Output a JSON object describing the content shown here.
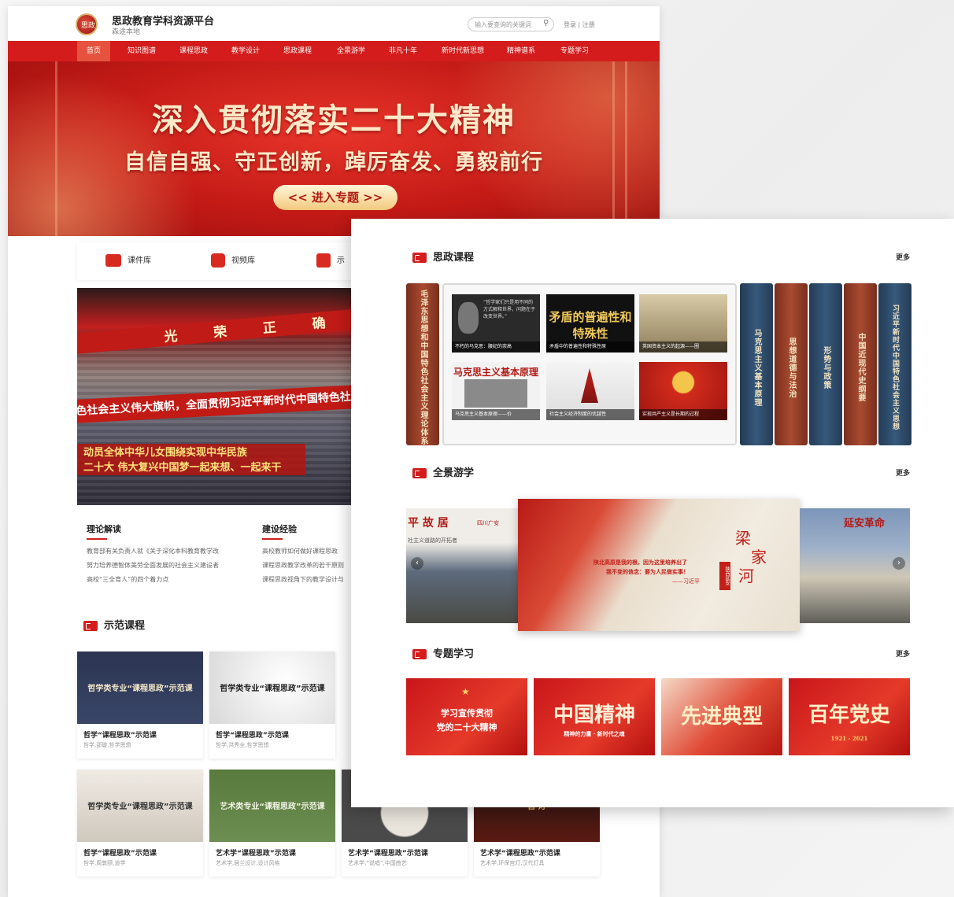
{
  "back": {
    "site_title": "思政教育学科资源平台",
    "site_sub": "森途本地",
    "search_placeholder": "输入要查询的关键词",
    "login": "登录 | 注册",
    "nav": [
      "首页",
      "知识图谱",
      "课程思政",
      "教学设计",
      "思政课程",
      "全景游学",
      "非凡十年",
      "新时代新思想",
      "精神谱系",
      "专题学习"
    ],
    "banner": {
      "title": "深入贯彻落实二十大精神",
      "subtitle": "自信自强、守正创新，踔厉奋发、勇毅前行",
      "button": "<< 进入专题 >>"
    },
    "resources": [
      "课件库",
      "视频库",
      "示"
    ],
    "photo": {
      "banner_text": "光 荣 正 确 的",
      "banner2_text": "色社会主义伟大旗帜，全面贯彻习近平新时代中国特色社会主义思",
      "slogan1": "动员全体中华儿女围绕实现中华民族",
      "slogan2": "二十大  伟大复兴中国梦一起来想、一起来干"
    },
    "news": [
      {
        "heading": "理论解读",
        "items": [
          "教育部有关负责人就《关于深化本科教育教学改",
          "努力培养德智体美劳全面发展的社会主义建设者",
          "高校“三全育人”的四个着力点"
        ]
      },
      {
        "heading": "建设经验",
        "items": [
          "高校教师如何做好课程思政",
          "课程思政教学改革的若干原则",
          "课程思政视角下的教学设计与"
        ]
      }
    ],
    "demo_heading": "示范课程",
    "cards": [
      {
        "img": "哲学类专业“课程思政”示范课",
        "title": "哲学“课程思政”示范课",
        "tags": "哲学,邵璇,哲学思想"
      },
      {
        "img": "哲学类专业“课程思政”示范课",
        "title": "哲学“课程思政”示范课",
        "tags": "哲学,洪秀全,哲学思想"
      },
      {
        "img": "哲学类专业“课程思政”示范课",
        "title": "哲学“课程思政”示范课",
        "tags": "哲学,周敦颐,道学"
      },
      {
        "img": "艺术类专业“课程思政”示范课",
        "title": "艺术学“课程思政”示范课",
        "tags": "艺术学,居兰设计,设计风格"
      },
      {
        "img": "",
        "title": "艺术学“课程思政”示范课",
        "tags": "艺术学,“说唱”,中国曲艺"
      },
      {
        "img": "宫 灯",
        "title": "艺术学“课程思政”示范课",
        "tags": "艺术学,环保宫灯,汉代灯具"
      }
    ]
  },
  "front": {
    "sections": [
      {
        "heading": "思政课程",
        "more": "更多"
      },
      {
        "heading": "全景游学",
        "more": "更多"
      },
      {
        "heading": "专题学习",
        "more": "更多"
      }
    ],
    "left_spine": "毛泽东思想和中国特色社会主义理论体系概论",
    "thumbs": [
      {
        "text": "“哲学家们只是用不同的方式解释世界，问题在于改变世界。”",
        "caption": "不朽的马克思：腰纪的崇高"
      },
      {
        "text": "矛盾的普遍性和特殊性",
        "caption": "矛盾中的普遍性和特殊性原"
      },
      {
        "text": "",
        "caption": "英国资本主义的起源——圈"
      },
      {
        "text": "马克思主义基本原理",
        "caption": "马克思主义基本原理——价"
      },
      {
        "text": "",
        "caption": "社会主义经济制度的优越性"
      },
      {
        "text": "",
        "caption": "实现共产主义是长期的过程"
      }
    ],
    "spines": [
      "马克思主义基本原理",
      "思想道德与法治",
      "形势与政策",
      "中国近现代史纲要",
      "习近平新时代中国特色社会主义思想"
    ],
    "panorama": {
      "left_title": "平 故 居",
      "left_tag": "四川广安",
      "left_sub": "社主义道路的开拓者",
      "mid_title_1": "梁",
      "mid_title_2": "家",
      "mid_title_3": "河",
      "mid_stamp": "陕西延安",
      "mid_quote_1": "陕北高原是我的根，因为这里培养出了",
      "mid_quote_2": "我不变的信念：要为人民做实事！",
      "mid_quote_3": "——习近平",
      "right_title": "延安革命"
    },
    "topics": [
      {
        "line1": "学习宣传贯彻",
        "line2": "党的二十大精神"
      },
      {
        "line1": "中国精神",
        "line2": "精神的力量 · 新时代之魂"
      },
      {
        "line1": "先进典型",
        "line2": ""
      },
      {
        "line1": "百年党史",
        "line2": "1921 - 2021"
      }
    ]
  },
  "colors": {
    "brand_red": "#d41c1c",
    "spine_blue": "#2f4a66",
    "spine_brown": "#8a3a26"
  }
}
